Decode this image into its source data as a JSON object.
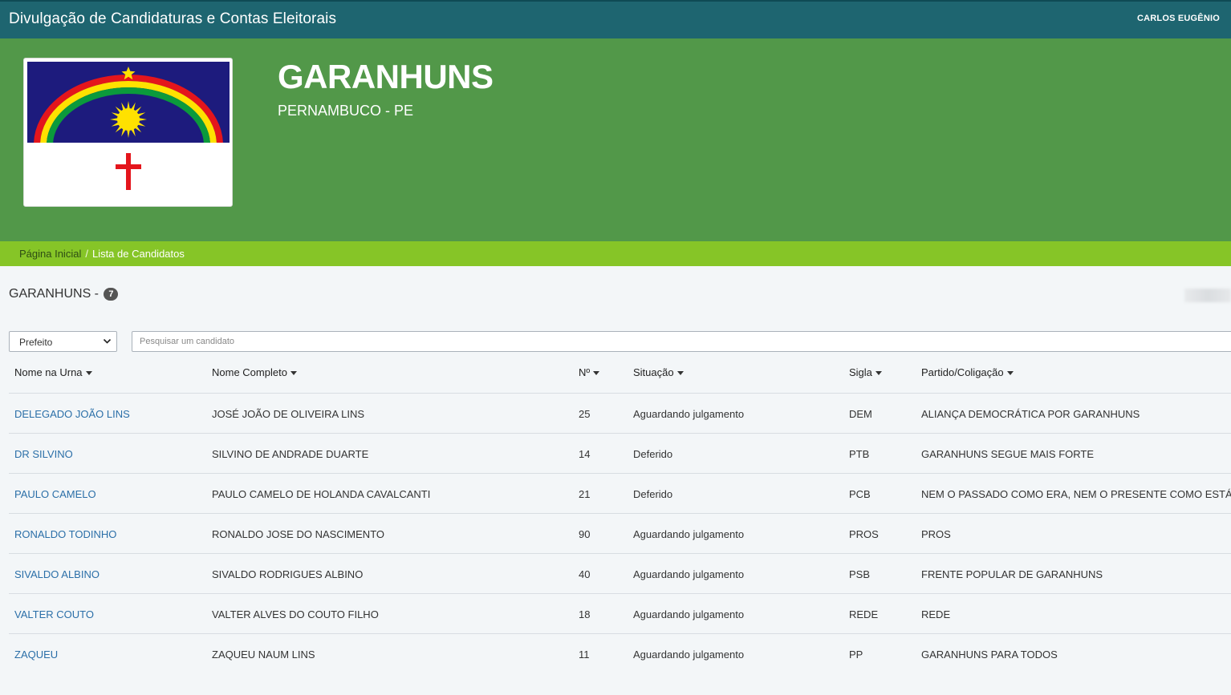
{
  "topbar": {
    "title": "Divulgação de Candidaturas e Contas Eleitorais",
    "user": "CARLOS EUGÊNIO"
  },
  "hero": {
    "city": "GARANHUNS",
    "state": "PERNAMBUCO - PE",
    "flag_colors": {
      "blue": "#1d1b7d",
      "red": "#e4151c",
      "yellow": "#ffe100",
      "green": "#0b9a3c",
      "white": "#ffffff"
    }
  },
  "breadcrumb": {
    "home": "Página Inicial",
    "separator": "/",
    "current": "Lista de Candidatos"
  },
  "list": {
    "title": "GARANHUNS -",
    "count": "7"
  },
  "filters": {
    "office_selected": "Prefeito",
    "search_placeholder": "Pesquisar um candidato"
  },
  "table": {
    "headers": {
      "urna": "Nome na Urna",
      "completo": "Nome Completo",
      "numero": "Nº",
      "situacao": "Situação",
      "sigla": "Sigla",
      "partido": "Partido/Coligação"
    },
    "rows": [
      {
        "urna": "DELEGADO JOÃO LINS",
        "completo": "JOSÉ JOÃO DE OLIVEIRA LINS",
        "numero": "25",
        "situacao": "Aguardando julgamento",
        "sigla": "DEM",
        "partido": "ALIANÇA DEMOCRÁTICA POR GARANHUNS"
      },
      {
        "urna": "DR SILVINO",
        "completo": "SILVINO DE ANDRADE DUARTE",
        "numero": "14",
        "situacao": "Deferido",
        "sigla": "PTB",
        "partido": "GARANHUNS SEGUE MAIS FORTE"
      },
      {
        "urna": "PAULO CAMELO",
        "completo": "PAULO CAMELO DE HOLANDA CAVALCANTI",
        "numero": "21",
        "situacao": "Deferido",
        "sigla": "PCB",
        "partido": "NEM O PASSADO COMO ERA, NEM O PRESENTE COMO ESTÁ"
      },
      {
        "urna": "RONALDO TODINHO",
        "completo": "RONALDO JOSE DO NASCIMENTO",
        "numero": "90",
        "situacao": "Aguardando julgamento",
        "sigla": "PROS",
        "partido": "PROS"
      },
      {
        "urna": "SIVALDO ALBINO",
        "completo": "SIVALDO RODRIGUES ALBINO",
        "numero": "40",
        "situacao": "Aguardando julgamento",
        "sigla": "PSB",
        "partido": "FRENTE POPULAR DE GARANHUNS"
      },
      {
        "urna": "VALTER COUTO",
        "completo": "VALTER ALVES DO COUTO FILHO",
        "numero": "18",
        "situacao": "Aguardando julgamento",
        "sigla": "REDE",
        "partido": "REDE"
      },
      {
        "urna": "ZAQUEU",
        "completo": "ZAQUEU NAUM LINS",
        "numero": "11",
        "situacao": "Aguardando julgamento",
        "sigla": "PP",
        "partido": "GARANHUNS PARA TODOS"
      }
    ]
  }
}
